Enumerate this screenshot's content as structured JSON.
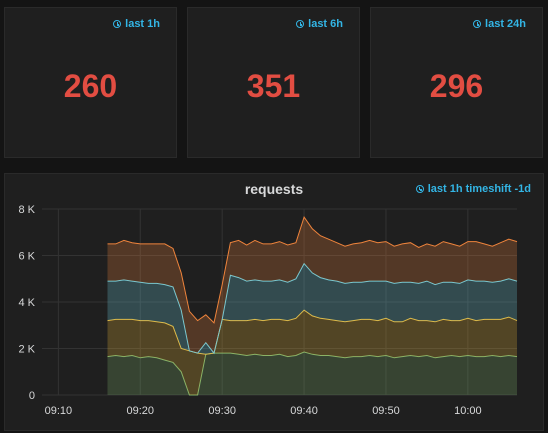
{
  "stats": [
    {
      "badge": "last 1h",
      "value": "260"
    },
    {
      "badge": "last 6h",
      "value": "351"
    },
    {
      "badge": "last 24h",
      "value": "296"
    }
  ],
  "graph": {
    "title": "requests",
    "badge": "last 1h timeshift -1d"
  },
  "colors": {
    "stat_value": "#e24d42",
    "badge": "#33b5e5",
    "series": [
      "#ef843c",
      "#6ed0e0",
      "#eab839",
      "#7eb26d"
    ]
  },
  "chart_data": {
    "type": "area",
    "stacked": true,
    "title": "requests",
    "x_ticks": [
      "09:10",
      "09:20",
      "09:30",
      "09:40",
      "09:50",
      "10:00"
    ],
    "y_ticks": [
      "0",
      "2 K",
      "4 K",
      "6 K",
      "8 K"
    ],
    "x_range_minutes": [
      8,
      66
    ],
    "ylim": [
      0,
      8000
    ],
    "grid": true,
    "x_minutes": [
      16,
      17,
      18,
      19,
      20,
      21,
      22,
      23,
      24,
      25,
      26,
      27,
      28,
      29,
      30,
      31,
      32,
      33,
      34,
      35,
      36,
      37,
      38,
      39,
      40,
      41,
      42,
      43,
      44,
      45,
      46,
      47,
      48,
      49,
      50,
      51,
      52,
      53,
      54,
      55,
      56,
      57,
      58,
      59,
      60,
      61,
      62,
      63,
      64,
      65,
      66
    ],
    "series": [
      {
        "color_key": 3,
        "values": [
          1650,
          1700,
          1650,
          1700,
          1600,
          1650,
          1600,
          1500,
          1400,
          1000,
          0,
          0,
          1750,
          1800,
          1800,
          1800,
          1750,
          1700,
          1750,
          1700,
          1700,
          1750,
          1650,
          1700,
          1850,
          1750,
          1700,
          1700,
          1650,
          1600,
          1650,
          1650,
          1700,
          1650,
          1700,
          1600,
          1650,
          1700,
          1650,
          1700,
          1600,
          1650,
          1700,
          1650,
          1700,
          1650,
          1650,
          1700,
          1650,
          1700,
          1650
        ]
      },
      {
        "color_key": 2,
        "values": [
          1550,
          1550,
          1600,
          1550,
          1600,
          1550,
          1550,
          1600,
          1550,
          1000,
          1900,
          1800,
          0,
          0,
          1450,
          1400,
          1450,
          1500,
          1500,
          1500,
          1550,
          1500,
          1550,
          1600,
          1800,
          1650,
          1600,
          1550,
          1550,
          1550,
          1550,
          1600,
          1550,
          1550,
          1600,
          1550,
          1500,
          1600,
          1550,
          1500,
          1550,
          1600,
          1500,
          1550,
          1600,
          1550,
          1600,
          1550,
          1600,
          1650,
          1550
        ]
      },
      {
        "color_key": 1,
        "values": [
          1700,
          1650,
          1700,
          1650,
          1650,
          1600,
          1650,
          1650,
          1700,
          1650,
          0,
          0,
          500,
          0,
          0,
          1950,
          1850,
          1700,
          1700,
          1700,
          1650,
          1700,
          1650,
          1700,
          2000,
          1850,
          1750,
          1700,
          1700,
          1650,
          1650,
          1600,
          1650,
          1700,
          1600,
          1650,
          1700,
          1550,
          1600,
          1700,
          1600,
          1600,
          1650,
          1600,
          1650,
          1700,
          1650,
          1600,
          1650,
          1650,
          1700
        ]
      },
      {
        "color_key": 0,
        "values": [
          1600,
          1600,
          1700,
          1650,
          1650,
          1700,
          1700,
          1750,
          1650,
          1600,
          1700,
          1400,
          1200,
          1300,
          1500,
          1400,
          1600,
          1550,
          1700,
          1600,
          1600,
          1650,
          1600,
          1550,
          2000,
          1900,
          1800,
          1750,
          1650,
          1600,
          1650,
          1700,
          1750,
          1650,
          1700,
          1600,
          1650,
          1700,
          1550,
          1600,
          1650,
          1750,
          1650,
          1600,
          1650,
          1700,
          1600,
          1550,
          1650,
          1700,
          1700
        ]
      }
    ]
  }
}
